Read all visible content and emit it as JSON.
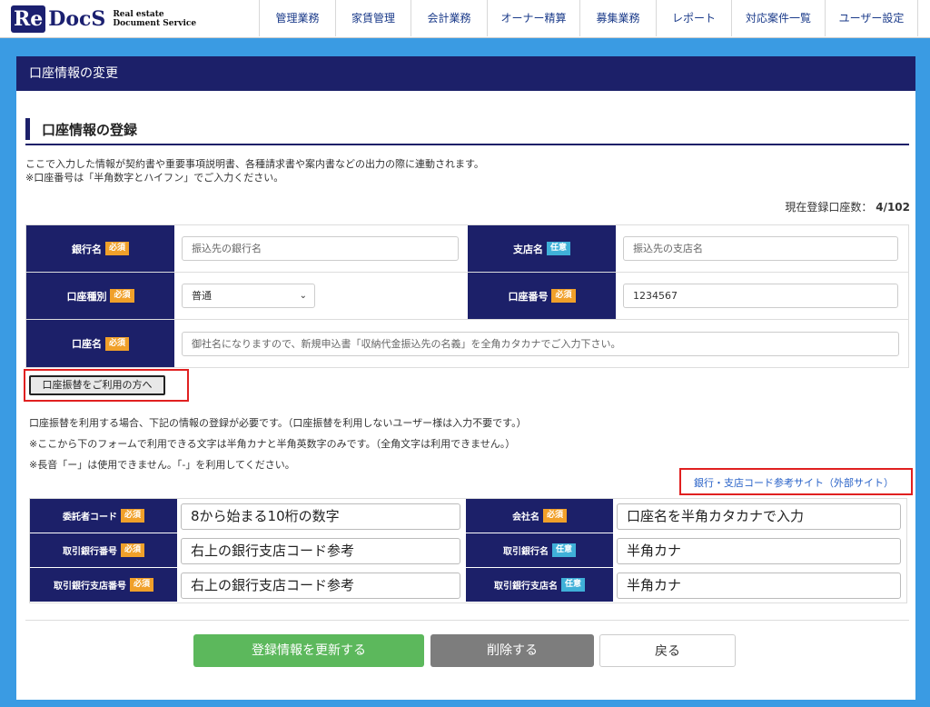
{
  "header": {
    "logo_re": "Re",
    "logo_docs": "DocS",
    "logo_tag_line1": "Real estate",
    "logo_tag_line2": "Document Service",
    "nav": [
      "管理業務",
      "家賃管理",
      "会計業務",
      "オーナー精算",
      "募集業務",
      "レポート",
      "対応案件一覧",
      "ユーザー設定"
    ]
  },
  "page": {
    "panel_title": "口座情報の変更",
    "section_title": "口座情報の登録",
    "note1": "ここで入力した情報が契約書や重要事項説明書、各種請求書や案内書などの出力の際に連動されます。",
    "note2": "※口座番号は「半角数字とハイフン」でご入力ください。",
    "count_label": "現在登録口座数：",
    "count_value": "4/102"
  },
  "badges": {
    "required": "必須",
    "optional": "任意"
  },
  "form": {
    "bank_name_label": "銀行名",
    "bank_name_placeholder": "振込先の銀行名",
    "branch_name_label": "支店名",
    "branch_name_placeholder": "振込先の支店名",
    "account_type_label": "口座種別",
    "account_type_value": "普通",
    "account_number_label": "口座番号",
    "account_number_value": "1234567",
    "account_holder_label": "口座名",
    "account_holder_placeholder": "御社名になりますので、新規申込書「収納代金振込先の名義」を全角カタカナでご入力下さい。"
  },
  "furikae": {
    "button": "口座振替をご利用の方へ",
    "note1": "口座振替を利用する場合、下記の情報の登録が必要です。（口座振替を利用しないユーザー様は入力不要です。）",
    "note2": "※ここから下のフォームで利用できる文字は半角カナと半角英数字のみです。（全角文字は利用できません。）",
    "note3": "※長音「ー」は使用できません。「-」を利用してください。",
    "external_link": "銀行・支店コード参考サイト（外部サイト）",
    "consignor_code_label": "委託者コード",
    "consignor_code_value": "8から始まる10桁の数字",
    "company_name_label": "会社名",
    "company_name_value": "口座名を半角カタカナで入力",
    "trade_bank_no_label": "取引銀行番号",
    "trade_bank_no_value": "右上の銀行支店コード参考",
    "trade_bank_name_label": "取引銀行名",
    "trade_bank_name_value": "半角カナ",
    "trade_branch_no_label": "取引銀行支店番号",
    "trade_branch_no_value": "右上の銀行支店コード参考",
    "trade_branch_name_label": "取引銀行支店名",
    "trade_branch_name_value": "半角カナ"
  },
  "actions": {
    "update": "登録情報を更新する",
    "delete": "削除する",
    "back": "戻る"
  },
  "colors": {
    "navy": "#1c2069",
    "background": "#3a9be3",
    "required": "#f0a02a",
    "optional": "#3fb0d8",
    "update_button": "#5cb85c",
    "delete_button": "#7d7d7d",
    "highlight_border": "#e02020"
  },
  "icons": {
    "select_chevron": "chevron-down-icon"
  }
}
